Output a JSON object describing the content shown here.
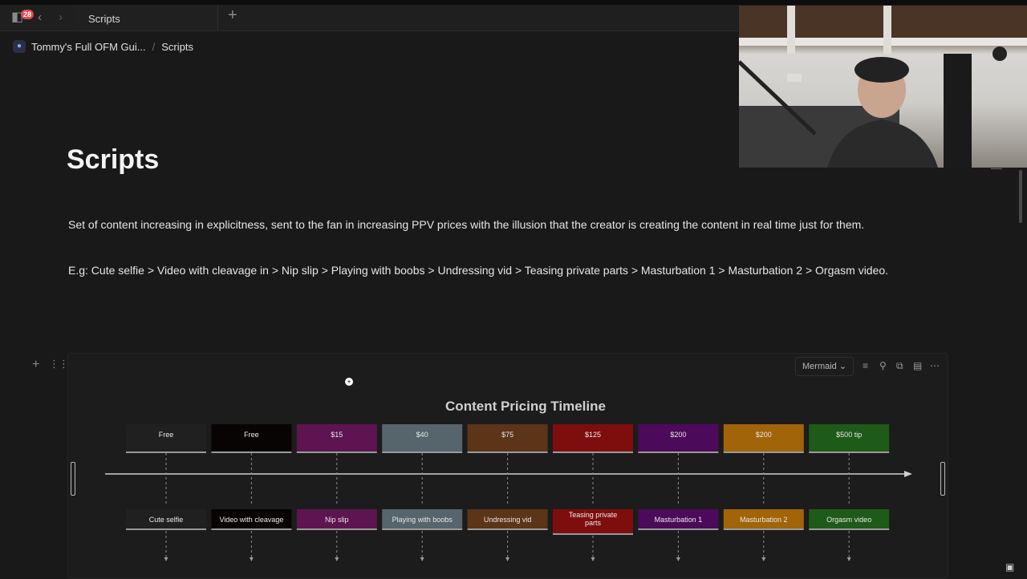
{
  "topbar": {
    "badge_count": "28",
    "tab_title": "Scripts",
    "new_tab_icon": "plus-icon"
  },
  "breadcrumb": {
    "workspace": "Tommy's Full OFM Gui...",
    "separator": "/",
    "page": "Scripts"
  },
  "page": {
    "title": "Scripts",
    "description": "Set of content increasing in explicitness, sent to the fan in increasing PPV prices with the illusion that the creator is creating the content in real time just for them.",
    "example": "E.g: Cute selfie > Video with cleavage in > Nip slip > Playing with boobs > Undressing vid > Teasing private parts > Masturbation 1 > Masturbation 2 > Orgasm video."
  },
  "code_block": {
    "language": "Mermaid",
    "toolbar_icons": [
      "wrap-icon",
      "zoom-icon",
      "copy-icon",
      "caption-icon",
      "more-icon"
    ]
  },
  "diagram": {
    "title": "Content Pricing Timeline",
    "steps": [
      {
        "price": "Free",
        "content": "Cute selfie",
        "color": "#202020"
      },
      {
        "price": "Free",
        "content": "Video with cleavage",
        "color": "#080404"
      },
      {
        "price": "$15",
        "content": "Nip slip",
        "color": "#5e1450"
      },
      {
        "price": "$40",
        "content": "Playing with boobs",
        "color": "#56646c"
      },
      {
        "price": "$75",
        "content": "Undressing vid",
        "color": "#5c3418"
      },
      {
        "price": "$125",
        "content": "Teasing private parts",
        "color": "#7e0d0d"
      },
      {
        "price": "$200",
        "content": "Masturbation 1",
        "color": "#4c0a5a"
      },
      {
        "price": "$200",
        "content": "Masturbation 2",
        "color": "#a26408"
      },
      {
        "price": "$500 tip",
        "content": "Orgasm video",
        "color": "#1e5a18"
      }
    ]
  }
}
